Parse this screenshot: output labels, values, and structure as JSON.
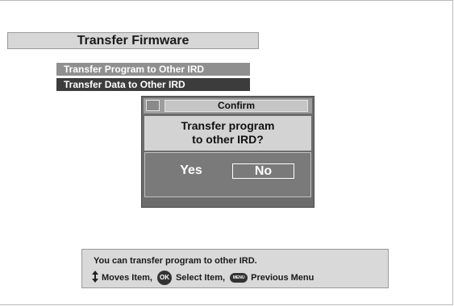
{
  "header": {
    "title": "Transfer Firmware"
  },
  "menu": {
    "items": [
      {
        "label": "Transfer Program to Other IRD"
      },
      {
        "label": "Transfer Data to Other IRD"
      }
    ]
  },
  "dialog": {
    "title": "Confirm",
    "message_line1": "Transfer program",
    "message_line2": "to other IRD?",
    "yes_label": "Yes",
    "no_label": "No"
  },
  "help": {
    "text": "You can transfer program to other IRD.",
    "moves": "Moves  Item,",
    "ok_icon_text": "OK",
    "select": "Select Item,",
    "menu_icon_text": "MENU",
    "previous": "Previous Menu"
  },
  "colors": {
    "selected_item": "#3c3c3c",
    "unselected_item": "#8f8f8f",
    "dialog_bg": "#6c6c6c"
  }
}
